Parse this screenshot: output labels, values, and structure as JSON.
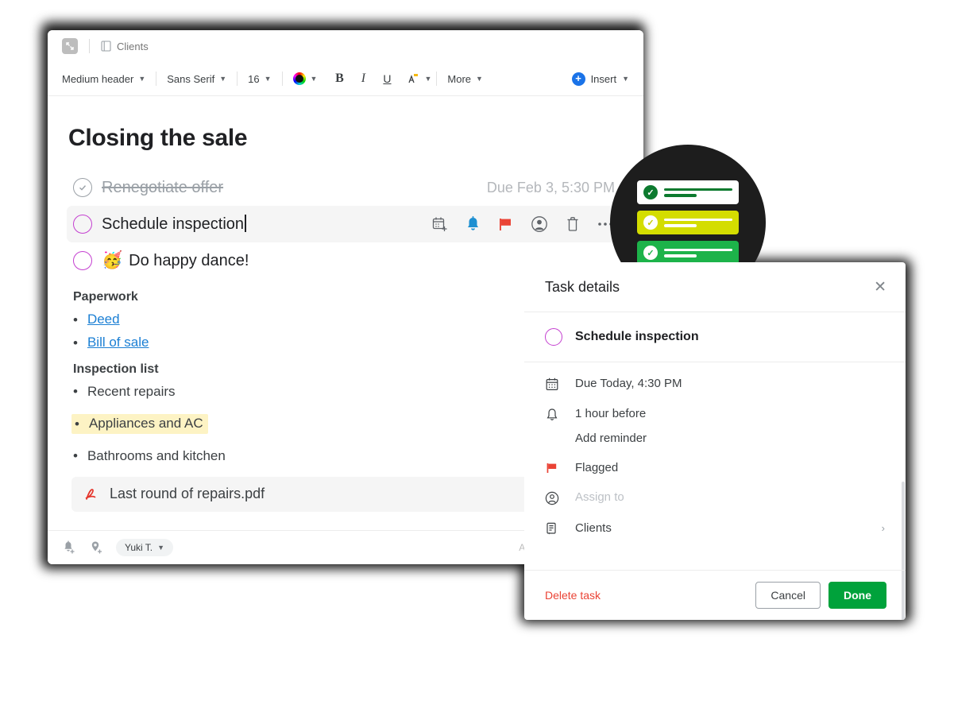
{
  "window": {
    "tab": {
      "label": "Clients",
      "icon": "document-icon"
    },
    "collapse_icon": "collapse-arrow-icon"
  },
  "toolbar": {
    "style": "Medium header",
    "font": "Sans Serif",
    "size": "16",
    "color_icon": "text-color-icon",
    "bold": "B",
    "italic": "I",
    "underline": "U",
    "highlight_icon": "highlight-icon",
    "more": "More",
    "insert": "Insert"
  },
  "document": {
    "title": "Closing the sale",
    "tasks": [
      {
        "title": "Renegotiate offer",
        "done": true,
        "due": "Due Feb 3, 5:30 PM"
      },
      {
        "title": "Schedule inspection",
        "done": false,
        "active": true,
        "icons": [
          "calendar-add-icon",
          "reminder-bell-icon",
          "flag-icon",
          "assign-person-icon",
          "delete-trash-icon",
          "more-options-icon"
        ]
      },
      {
        "emoji": "🥳",
        "title": "Do happy dance!",
        "done": false
      }
    ],
    "sections": [
      {
        "heading": "Paperwork",
        "items": [
          {
            "text": "Deed",
            "link": true
          },
          {
            "text": "Bill of sale",
            "link": true
          }
        ]
      },
      {
        "heading": "Inspection list",
        "items": [
          {
            "text": "Recent repairs"
          },
          {
            "text": "Appliances and AC",
            "highlighted": true
          },
          {
            "text": "Bathrooms and kitchen"
          }
        ]
      }
    ],
    "attachment": {
      "name": "Last round of repairs.pdf",
      "icon": "pdf-icon"
    }
  },
  "statusbar": {
    "add_reminder_icon": "add-reminder-icon",
    "add_location_icon": "add-location-icon",
    "user": "Yuki T.",
    "saved": "All chan"
  },
  "badge": {
    "cards": [
      {
        "style": "white",
        "check": "✓"
      },
      {
        "style": "lime",
        "check": "✓"
      },
      {
        "style": "green",
        "check": "✓"
      }
    ]
  },
  "panel": {
    "title": "Task details",
    "close_icon": "close-icon",
    "task_name": "Schedule inspection",
    "rows": [
      {
        "icon": "calendar-icon",
        "text": "Due Today, 4:30 PM"
      },
      {
        "icon": "bell-icon",
        "text": "1 hour before",
        "sub": "Add reminder"
      },
      {
        "icon": "flag-icon",
        "text": "Flagged"
      },
      {
        "icon": "person-circle-icon",
        "text": "Assign to",
        "muted": true
      },
      {
        "icon": "list-icon",
        "text": "Clients",
        "chevron": "›"
      }
    ],
    "delete": "Delete task",
    "cancel": "Cancel",
    "done": "Done"
  },
  "colors": {
    "accent_green": "#00a23b",
    "flag_red": "#ea4335",
    "link_blue": "#1b7fd4",
    "checkbox_purple": "#c43fd0",
    "highlight_yellow": "#fdf3c4",
    "badge_dark": "#1d1d1d",
    "badge_lime": "#d4dd00",
    "badge_green": "#1db34a"
  }
}
